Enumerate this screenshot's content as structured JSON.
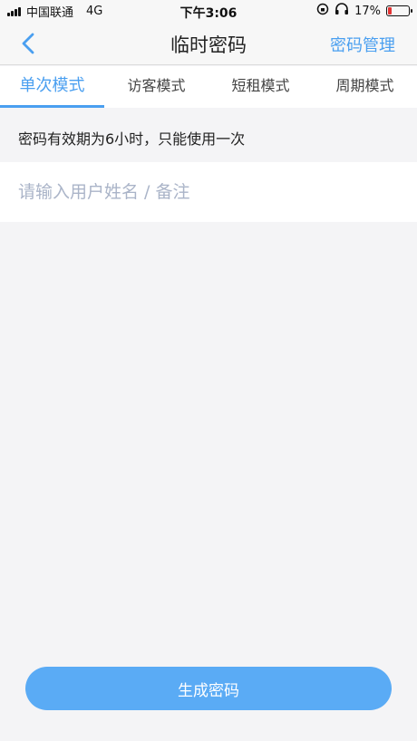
{
  "status_bar": {
    "carrier": "中国联通",
    "network": "4G",
    "time": "下午3:06",
    "battery_percent": "17%",
    "battery_level": 0.17
  },
  "navbar": {
    "title": "临时密码",
    "right_action": "密码管理"
  },
  "tabs": [
    {
      "label": "单次模式",
      "active": true
    },
    {
      "label": "访客模式",
      "active": false
    },
    {
      "label": "短租模式",
      "active": false
    },
    {
      "label": "周期模式",
      "active": false
    }
  ],
  "hint": "密码有效期为6小时，只能使用一次",
  "name_input": {
    "placeholder": "请输入用户姓名 / 备注",
    "value": ""
  },
  "generate_button": "生成密码",
  "colors": {
    "accent": "#4a9ff0",
    "button": "#5aabf5",
    "battery_low": "#e33333"
  }
}
